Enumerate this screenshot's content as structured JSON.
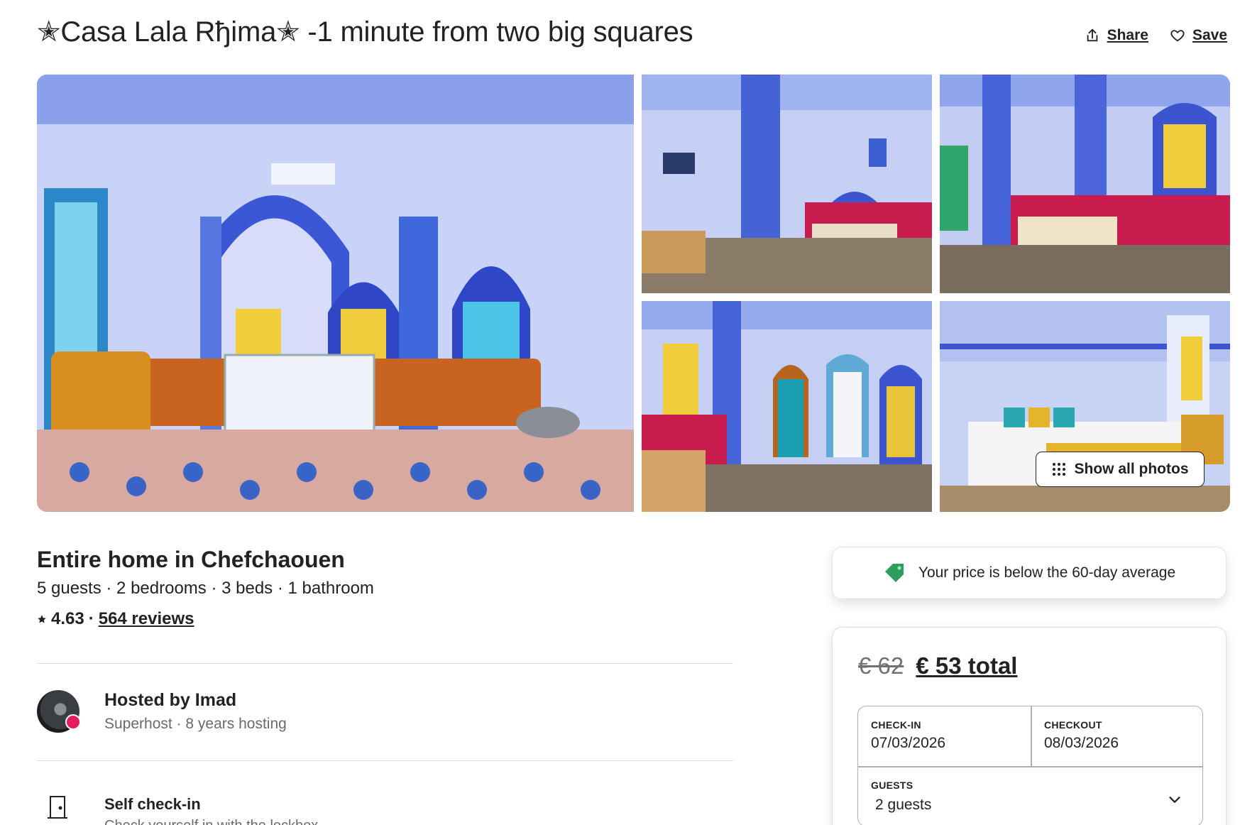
{
  "listing": {
    "title": "✭Casa Lala Rђima✭ -1 minute from two big squares",
    "share_label": "Share",
    "save_label": "Save",
    "show_all_photos_label": "Show all photos",
    "home_type": "Entire home in Chefchaouen",
    "facts": "5 guests · 2 bedrooms · 3 beds · 1 bathroom",
    "rating": "4.63",
    "rating_separator": "·",
    "reviews_label": "564 reviews"
  },
  "host": {
    "hosted_by": "Hosted by Imad",
    "meta": "Superhost · 8 years hosting"
  },
  "highlights": [
    {
      "title": "Self check-in",
      "subtitle": "Check yourself in with the lockbox."
    }
  ],
  "price_note": {
    "text": "Your price is below the 60-day average",
    "icon": "price-tag-icon",
    "icon_color": "#2e9e5b"
  },
  "booking": {
    "old_price": "€ 62",
    "total_price": "€ 53 total",
    "checkin_label": "CHECK-IN",
    "checkin_value": "07/03/2026",
    "checkout_label": "CHECKOUT",
    "checkout_value": "08/03/2026",
    "guests_label": "GUESTS",
    "guests_value": "2 guests"
  },
  "colors": {
    "text": "#222222",
    "muted": "#6a6a6a",
    "superhost_badge": "#e31c5f",
    "room_blue": "#3f5fd8",
    "sofa_orange": "#c8641f",
    "sofa_pink": "#c8184a"
  }
}
